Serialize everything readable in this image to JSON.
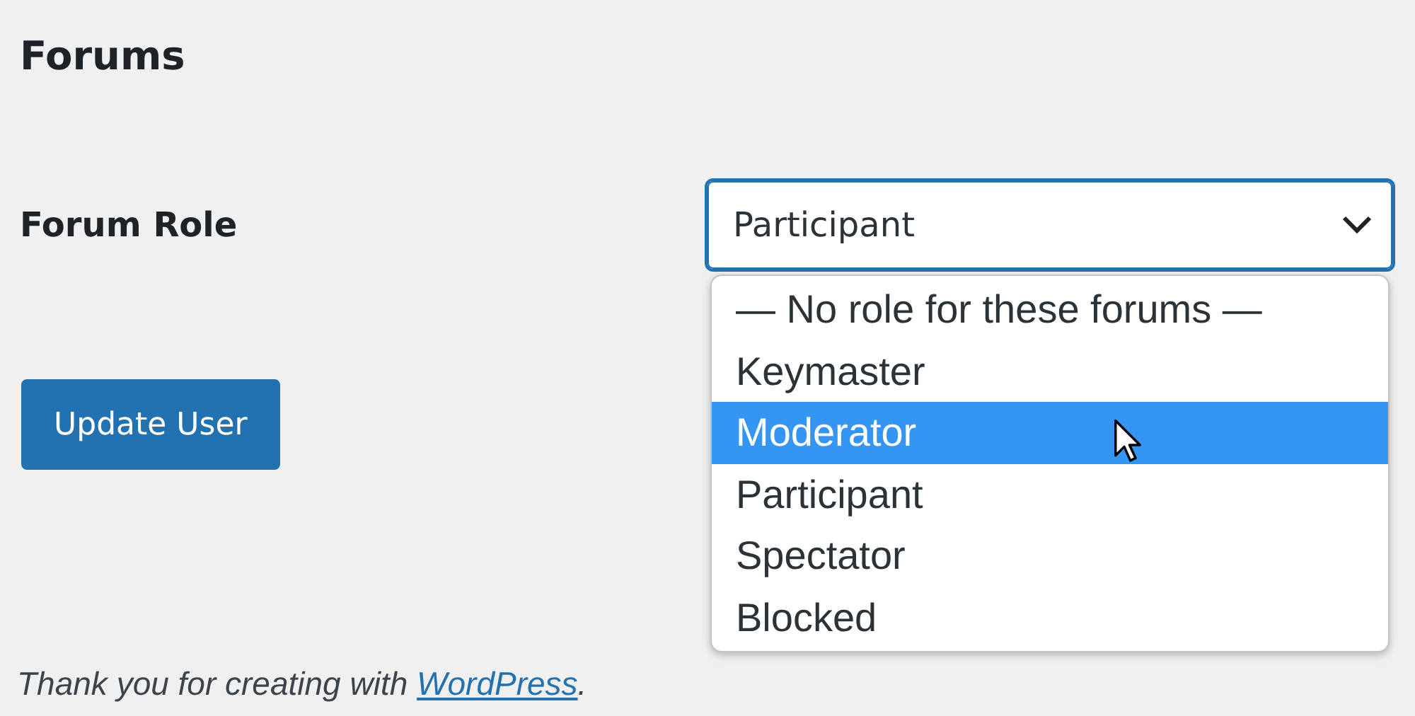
{
  "heading": "Forums",
  "field": {
    "label": "Forum Role",
    "value": "Participant",
    "expanded": true,
    "options": [
      {
        "label": "— No role for these forums —",
        "highlighted": false
      },
      {
        "label": "Keymaster",
        "highlighted": false
      },
      {
        "label": "Moderator",
        "highlighted": true
      },
      {
        "label": "Participant",
        "highlighted": false
      },
      {
        "label": "Spectator",
        "highlighted": false
      },
      {
        "label": "Blocked",
        "highlighted": false
      }
    ]
  },
  "button": "Update User",
  "footer": {
    "text": "Thank you for creating with ",
    "link": "WordPress",
    "after": "."
  }
}
